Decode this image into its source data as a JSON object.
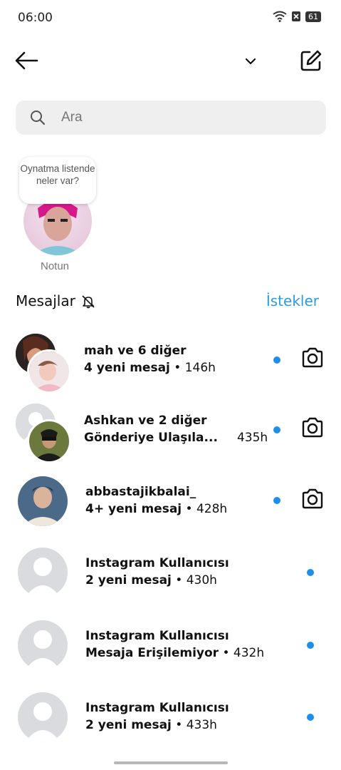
{
  "status": {
    "time": "06:00",
    "battery": "61"
  },
  "search": {
    "placeholder": "Ara"
  },
  "note": {
    "bubble": "Oynatma listende neler var?",
    "label": "Notun"
  },
  "section": {
    "title": "Mesajlar",
    "requests": "İstekler"
  },
  "threads": [
    {
      "name": "mah ve 6 diğer",
      "status": "4 yeni mesaj",
      "time": "146h",
      "camera": true
    },
    {
      "name": "Ashkan ve 2 diğer",
      "status": "Gönderiye Ulaşıla...",
      "time": "435h",
      "camera": true
    },
    {
      "name": "abbastajikbalai_",
      "status": "4+ yeni mesaj",
      "time": "428h",
      "camera": true
    },
    {
      "name": "Instagram Kullanıcısı",
      "status": "2 yeni mesaj",
      "time": "430h",
      "camera": false
    },
    {
      "name": "Instagram Kullanıcısı",
      "status": "Mesaja Erişilemiyor",
      "time": "432h",
      "camera": false
    },
    {
      "name": "Instagram Kullanıcısı",
      "status": "2 yeni mesaj",
      "time": "433h",
      "camera": false
    }
  ],
  "icons": [
    "back-arrow-icon",
    "chevron-down-icon",
    "compose-icon",
    "search-icon",
    "bell-off-icon",
    "camera-icon",
    "wifi-icon",
    "sim-off-icon",
    "battery-icon"
  ],
  "colors": {
    "accent": "#2d9be6",
    "unread_dot": "#1d8fe8",
    "search_bg": "#efefef"
  }
}
